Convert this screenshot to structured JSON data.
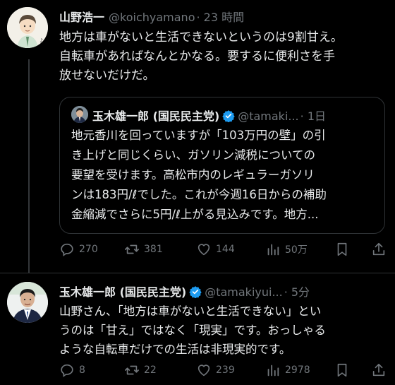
{
  "tweet1": {
    "name": "山野浩一",
    "handle": "@koichyamano",
    "time": "· 23 時間",
    "lines": [
      "地方は車がないと生活できないというのは9割甘え。",
      "自転車があればなんとかなる。要するに便利さを手",
      "放せないだけだ。"
    ],
    "quote": {
      "name": "玉木雄一郎 (国民民主党)",
      "handle": "@tamaki...",
      "time": "· 1日",
      "lines": [
        "地元香川を回っていますが「103万円の壁」の引",
        "き上げと同じくらい、ガソリン減税についての",
        "要望を受けます。高松市内のレギュラーガソリ",
        "ンは183円/ℓでした。これが今週16日からの補助",
        "金縮減でさらに5円/ℓ上がる見込みです。地方..."
      ]
    },
    "actions": {
      "replies": "270",
      "retweets": "381",
      "likes": "144",
      "views": "50万"
    }
  },
  "tweet2": {
    "name": "玉木雄一郎 (国民民主党)",
    "handle": "@tamakiyui...",
    "time": "· 5分",
    "lines": [
      "山野さん、「地方は車がないと生活できない」とい",
      "うのは「甘え」ではなく「現実」です。おっしゃる",
      "ような自転車だけでの生活は非現実的です。"
    ],
    "actions": {
      "replies": "8",
      "retweets": "22",
      "likes": "239",
      "views": "2978"
    }
  },
  "colors": {
    "background": "#000000",
    "text": "#e7e9ea",
    "muted": "#71767b",
    "verified": "#1d9bf0",
    "border": "#2f3336"
  }
}
